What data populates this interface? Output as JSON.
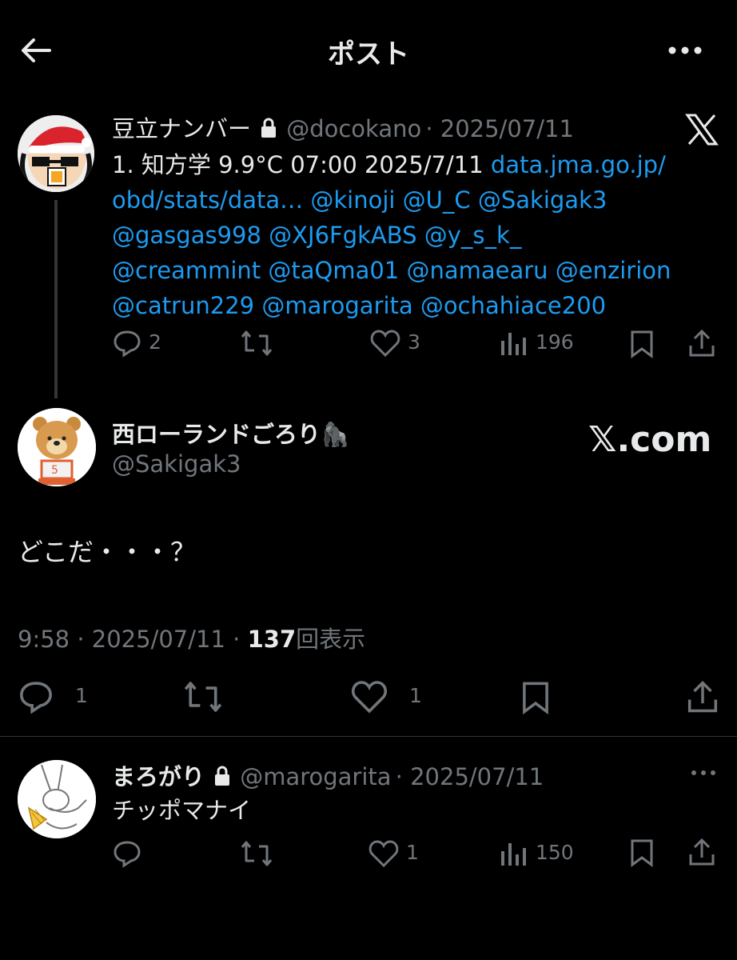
{
  "header": {
    "title": "ポスト",
    "back_icon": "arrow-left-icon",
    "more_icon": "more-horizontal-icon"
  },
  "quoted_post": {
    "display_name": "豆立ナンバー",
    "lock_icon": "lock-icon",
    "handle": "@docokano",
    "date": "· 2025/07/11",
    "x_logo": "x-logo-icon",
    "text_plain": "1. 知方学 9.9°C 07:00 2025/7/11",
    "link_line1": "data.jma.go.jp/",
    "line2": "obd/stats/data… @kinoji @U_C @Sakigak3",
    "line3": "@gasgas998 @XJ6FgkABS @y_s_k_",
    "line4": "@creammint @taQma01 @namaearu @enzirion",
    "line5": "@catrun229 @marogarita @ochahiace200",
    "replies": "2",
    "likes": "3",
    "views": "196"
  },
  "main_post": {
    "display_name": "西ローランドごろり",
    "emoji": "🦍",
    "handle": "@Sakigak3",
    "watermark": "𝕏.com",
    "text": "どこだ・・・？",
    "time": "9:58 · 2025/07/11 ·",
    "view_count": "137",
    "view_label": "回表示",
    "replies": "1",
    "likes": "1"
  },
  "reply_post": {
    "display_name": "まろがり",
    "lock_icon": "lock-icon",
    "handle": "@marogarita",
    "date": "· 2025/07/11",
    "text": "チッポマナイ",
    "likes": "1",
    "views": "150"
  },
  "colors": {
    "background": "#000000",
    "link": "#1d9bf0",
    "muted": "#71767b",
    "text": "#e7e9ea"
  }
}
